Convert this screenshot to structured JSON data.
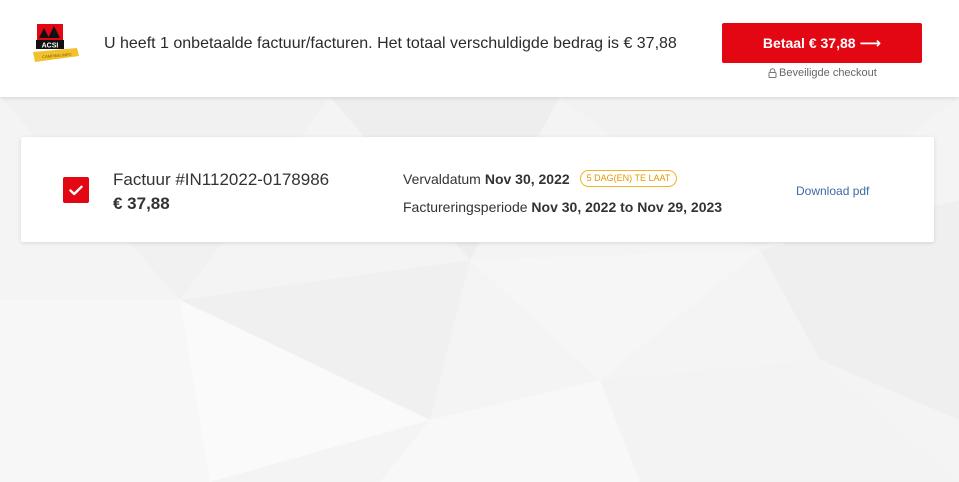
{
  "header": {
    "logo_text": "ACSI",
    "logo_ribbon_text": "CAMPING.INFO",
    "message": "U heeft 1 onbetaalde factuur/facturen. Het totaal verschuldigde bedrag is € 37,88",
    "pay_button_label": "Betaal € 37,88",
    "pay_button_arrow": "⟶",
    "secure_checkout_label": "Beveiligde checkout"
  },
  "invoice": {
    "checked": true,
    "title": "Factuur #IN112022-0178986",
    "amount": "€ 37,88",
    "due_label": "Vervaldatum",
    "due_date": "Nov 30, 2022",
    "overdue_badge": "5 DAG(EN) TE LAAT",
    "period_label": "Factureringsperiode",
    "period_value": "Nov 30, 2022 to Nov 29, 2023",
    "download_label": "Download pdf"
  },
  "colors": {
    "brand_red": "#e30613",
    "badge_orange": "#f0b429",
    "link_blue": "#3d6aa7"
  }
}
